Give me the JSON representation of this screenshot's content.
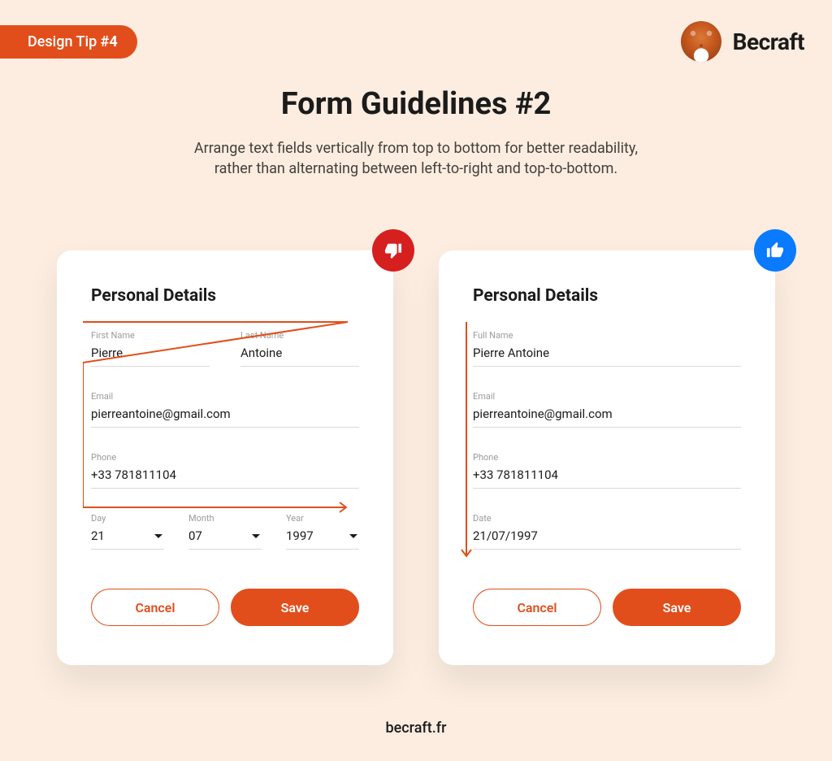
{
  "header": {
    "tip_prefix": "Design Tip ",
    "tip_number": "#4",
    "brand": "Becraft"
  },
  "title": "Form Guidelines #2",
  "subtitle": "Arrange text fields vertically from top to bottom for better readability, rather than alternating between left-to-right and top-to-bottom.",
  "bad": {
    "heading": "Personal Details",
    "first_name_label": "First Name",
    "first_name_value": "Pierre",
    "last_name_label": "Last Name",
    "last_name_value": "Antoine",
    "email_label": "Email",
    "email_value": "pierreantoine@gmail.com",
    "phone_label": "Phone",
    "phone_value": "+33 781811104",
    "day_label": "Day",
    "day_value": "21",
    "month_label": "Month",
    "month_value": "07",
    "year_label": "Year",
    "year_value": "1997",
    "cancel": "Cancel",
    "save": "Save"
  },
  "good": {
    "heading": "Personal Details",
    "full_name_label": "Full Name",
    "full_name_value": "Pierre Antoine",
    "email_label": "Email",
    "email_value": "pierreantoine@gmail.com",
    "phone_label": "Phone",
    "phone_value": "+33 781811104",
    "date_label": "Date",
    "date_value": "21/07/1997",
    "cancel": "Cancel",
    "save": "Save"
  },
  "footer": "becraft.fr"
}
